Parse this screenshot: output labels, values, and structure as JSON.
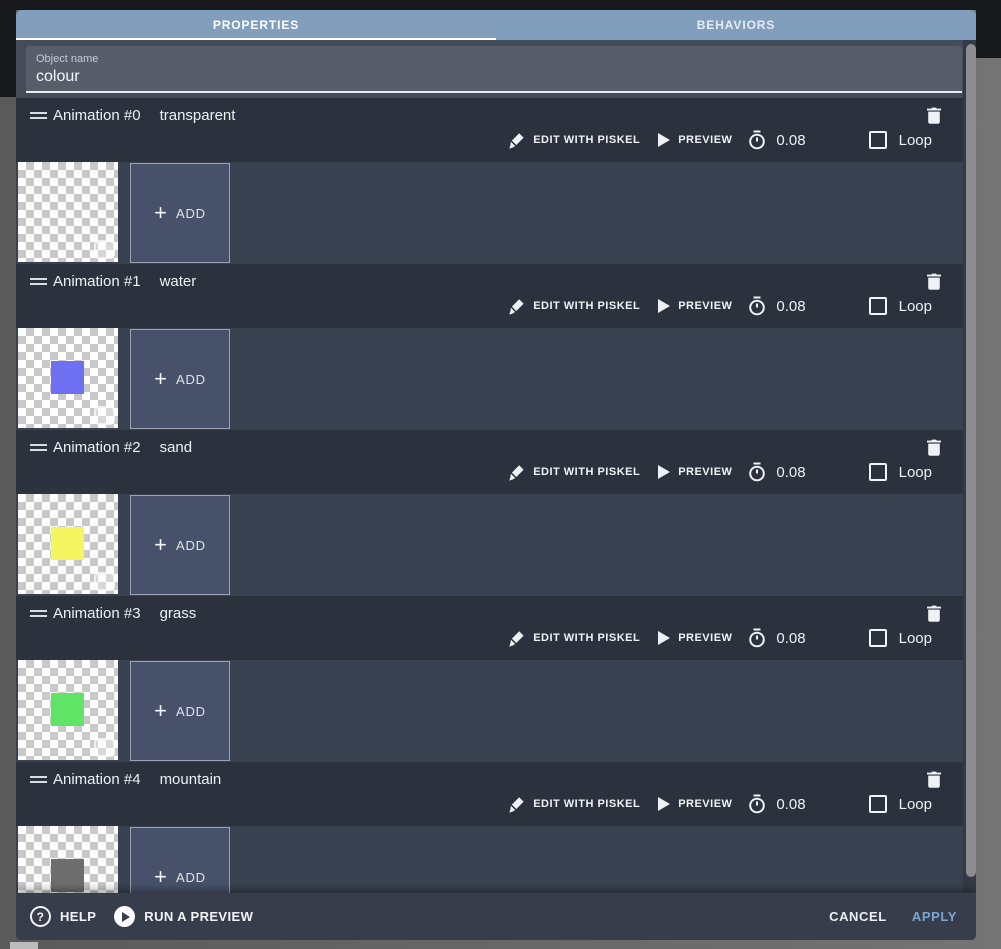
{
  "tab_bar": {
    "tabs": [
      {
        "label": "PROPERTIES",
        "active": true
      },
      {
        "label": "BEHAVIORS",
        "active": false
      }
    ]
  },
  "object_name": {
    "label": "Object name",
    "value": "colour"
  },
  "animation_common": {
    "edit_label": "EDIT WITH PISKEL",
    "preview_label": "PREVIEW",
    "frame_time": "0.08",
    "loop_label": "Loop",
    "loop_checked": false,
    "add_label": "ADD"
  },
  "animations": [
    {
      "title": "Animation #0",
      "name": "transparent",
      "frame_color": ""
    },
    {
      "title": "Animation #1",
      "name": "water",
      "frame_color": "#6f6ff2"
    },
    {
      "title": "Animation #2",
      "name": "sand",
      "frame_color": "#f5f562"
    },
    {
      "title": "Animation #3",
      "name": "grass",
      "frame_color": "#5fe565"
    },
    {
      "title": "Animation #4",
      "name": "mountain",
      "frame_color": "#6e6e6e"
    }
  ],
  "footer": {
    "help_label": "HELP",
    "run_label": "RUN A PREVIEW",
    "cancel_label": "CANCEL",
    "apply_label": "APPLY"
  },
  "colors": {
    "tab_bar": "#829ebd",
    "section_header": "#2b313d",
    "frames_strip": "#3a4150",
    "dialog_base": "#454b59",
    "footer_bar": "#373d4b",
    "apply_accent": "#7ba6d2",
    "checker_gray": "#c9c9c9"
  }
}
